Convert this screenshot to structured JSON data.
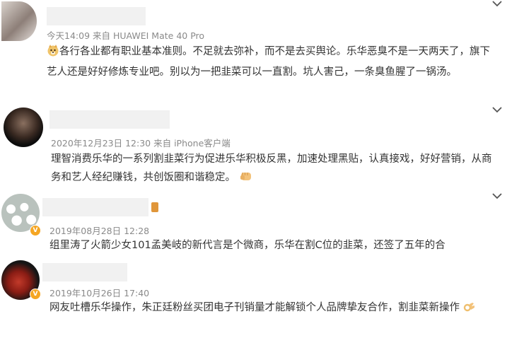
{
  "comments": [
    {
      "meta": "今天14:09  来自 HUAWEI Mate 40 Pro",
      "emoji": "doge-emoji",
      "text": "各行各业都有职业基本准则。不足就去弥补，而不是去买舆论。乐华恶臭不是一天两天了，旗下艺人还是好好修炼专业吧。别以为一把韭菜可以一直割。坑人害己，一条臭鱼腥了一锅汤。"
    },
    {
      "meta": "2020年12月23日 12:30  来自 iPhone客户端",
      "text": "理智消费乐华的一系列割韭菜行为促进乐华积极反黑，加速处理黑贴，认真接戏，好好营销，从商务和艺人经纪赚钱，共创饭圈和谐稳定。",
      "emoji": "fist-emoji"
    },
    {
      "meta": "2019年08月28日 12:28",
      "text": "组里涛了火箭少女101孟美岐的新代言是个微商，乐华在割C位的韭菜，还签了五年的合"
    },
    {
      "meta": "2019年10月26日 17:40",
      "text": "网友吐槽乐华操作，朱正廷粉丝买团电子刊销量才能解锁个人品牌挚友合作，割韭菜新操作",
      "emoji": "ok-hand-emoji"
    }
  ],
  "colors": {
    "meta": "#8a8a8a",
    "text": "#333333",
    "badge": "#f5a623"
  }
}
